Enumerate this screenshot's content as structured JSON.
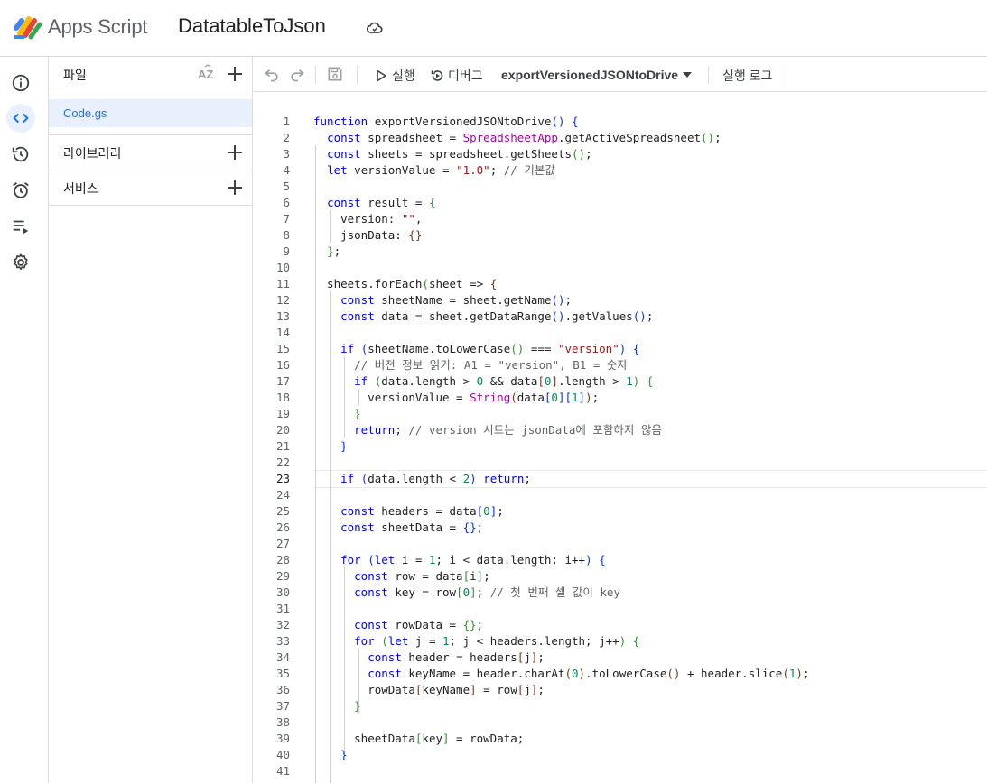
{
  "header": {
    "app_name": "Apps Script",
    "project_title": "DatatableToJson"
  },
  "filepanel": {
    "files_label": "파일",
    "files": [
      "Code.gs"
    ],
    "libraries_label": "라이브러리",
    "services_label": "서비스"
  },
  "toolbar": {
    "run_label": "실행",
    "debug_label": "디버그",
    "function_name": "exportVersionedJSONtoDrive",
    "log_label": "실행 로그"
  },
  "editor": {
    "current_line": 23,
    "lines": [
      [
        [
          "k",
          "function"
        ],
        [
          "f",
          " exportVersionedJSONtoDrive"
        ],
        [
          "b1",
          "()"
        ],
        [
          "f",
          " "
        ],
        [
          "b1",
          "{"
        ]
      ],
      [
        [
          "f",
          "  "
        ],
        [
          "k",
          "const"
        ],
        [
          "f",
          " spreadsheet = "
        ],
        [
          "cl",
          "SpreadsheetApp"
        ],
        [
          "f",
          ".getActiveSpreadsheet"
        ],
        [
          "b2",
          "()"
        ],
        [
          "f",
          ";"
        ]
      ],
      [
        [
          "f",
          "  "
        ],
        [
          "k",
          "const"
        ],
        [
          "f",
          " sheets = spreadsheet.getSheets"
        ],
        [
          "b2",
          "()"
        ],
        [
          "f",
          ";"
        ]
      ],
      [
        [
          "f",
          "  "
        ],
        [
          "k",
          "let"
        ],
        [
          "f",
          " versionValue = "
        ],
        [
          "s",
          "\"1.0\""
        ],
        [
          "f",
          "; "
        ],
        [
          "c",
          "// 기본값"
        ]
      ],
      [
        [
          "f",
          ""
        ]
      ],
      [
        [
          "f",
          "  "
        ],
        [
          "k",
          "const"
        ],
        [
          "f",
          " result = "
        ],
        [
          "b2",
          "{"
        ]
      ],
      [
        [
          "f",
          "    version: "
        ],
        [
          "s",
          "\"\""
        ],
        [
          "f",
          ","
        ]
      ],
      [
        [
          "f",
          "    jsonData: "
        ],
        [
          "b3",
          "{}"
        ]
      ],
      [
        [
          "f",
          "  "
        ],
        [
          "b2",
          "}"
        ],
        [
          "f",
          ";"
        ]
      ],
      [
        [
          "f",
          ""
        ]
      ],
      [
        [
          "f",
          "  sheets.forEach"
        ],
        [
          "b2",
          "("
        ],
        [
          "f",
          "sheet => "
        ],
        [
          "b3",
          "{"
        ]
      ],
      [
        [
          "f",
          "    "
        ],
        [
          "k",
          "const"
        ],
        [
          "f",
          " sheetName = sheet.getName"
        ],
        [
          "b1",
          "()"
        ],
        [
          "f",
          ";"
        ]
      ],
      [
        [
          "f",
          "    "
        ],
        [
          "k",
          "const"
        ],
        [
          "f",
          " data = sheet.getDataRange"
        ],
        [
          "b1",
          "()"
        ],
        [
          "f",
          ".getValues"
        ],
        [
          "b1",
          "()"
        ],
        [
          "f",
          ";"
        ]
      ],
      [
        [
          "f",
          ""
        ]
      ],
      [
        [
          "f",
          "    "
        ],
        [
          "k",
          "if"
        ],
        [
          "f",
          " "
        ],
        [
          "b1",
          "("
        ],
        [
          "f",
          "sheetName.toLowerCase"
        ],
        [
          "b2",
          "()"
        ],
        [
          "f",
          " === "
        ],
        [
          "s",
          "\"version\""
        ],
        [
          "b1",
          ")"
        ],
        [
          "f",
          " "
        ],
        [
          "b1",
          "{"
        ]
      ],
      [
        [
          "f",
          "      "
        ],
        [
          "c",
          "// 버전 정보 읽기: A1 = \"version\", B1 = 숫자"
        ]
      ],
      [
        [
          "f",
          "      "
        ],
        [
          "k",
          "if"
        ],
        [
          "f",
          " "
        ],
        [
          "b2",
          "("
        ],
        [
          "f",
          "data.length > "
        ],
        [
          "n",
          "0"
        ],
        [
          "f",
          " && data"
        ],
        [
          "b3",
          "["
        ],
        [
          "n",
          "0"
        ],
        [
          "b3",
          "]"
        ],
        [
          "f",
          ".length > "
        ],
        [
          "n",
          "1"
        ],
        [
          "b2",
          ")"
        ],
        [
          "f",
          " "
        ],
        [
          "b2",
          "{"
        ]
      ],
      [
        [
          "f",
          "        versionValue = "
        ],
        [
          "cl",
          "String"
        ],
        [
          "b3",
          "("
        ],
        [
          "f",
          "data"
        ],
        [
          "b1",
          "["
        ],
        [
          "n",
          "0"
        ],
        [
          "b1",
          "]["
        ],
        [
          "n",
          "1"
        ],
        [
          "b1",
          "]"
        ],
        [
          "b3",
          ")"
        ],
        [
          "f",
          ";"
        ]
      ],
      [
        [
          "f",
          "      "
        ],
        [
          "b2",
          "}"
        ]
      ],
      [
        [
          "f",
          "      "
        ],
        [
          "k",
          "return"
        ],
        [
          "f",
          "; "
        ],
        [
          "c",
          "// version 시트는 jsonData에 포함하지 않음"
        ]
      ],
      [
        [
          "f",
          "    "
        ],
        [
          "b1",
          "}"
        ]
      ],
      [
        [
          "f",
          ""
        ]
      ],
      [
        [
          "f",
          "    "
        ],
        [
          "k",
          "if"
        ],
        [
          "f",
          " "
        ],
        [
          "b1",
          "("
        ],
        [
          "f",
          "data.length < "
        ],
        [
          "n",
          "2"
        ],
        [
          "b1",
          ")"
        ],
        [
          "f",
          " "
        ],
        [
          "k",
          "return"
        ],
        [
          "f",
          ";"
        ]
      ],
      [
        [
          "f",
          ""
        ]
      ],
      [
        [
          "f",
          "    "
        ],
        [
          "k",
          "const"
        ],
        [
          "f",
          " headers = data"
        ],
        [
          "b1",
          "["
        ],
        [
          "n",
          "0"
        ],
        [
          "b1",
          "]"
        ],
        [
          "f",
          ";"
        ]
      ],
      [
        [
          "f",
          "    "
        ],
        [
          "k",
          "const"
        ],
        [
          "f",
          " sheetData = "
        ],
        [
          "b1",
          "{}"
        ],
        [
          "f",
          ";"
        ]
      ],
      [
        [
          "f",
          ""
        ]
      ],
      [
        [
          "f",
          "    "
        ],
        [
          "k",
          "for"
        ],
        [
          "f",
          " "
        ],
        [
          "b1",
          "("
        ],
        [
          "k",
          "let"
        ],
        [
          "f",
          " i = "
        ],
        [
          "n",
          "1"
        ],
        [
          "f",
          "; i < data.length; i++"
        ],
        [
          "b1",
          ")"
        ],
        [
          "f",
          " "
        ],
        [
          "b1",
          "{"
        ]
      ],
      [
        [
          "f",
          "      "
        ],
        [
          "k",
          "const"
        ],
        [
          "f",
          " row = data"
        ],
        [
          "b2",
          "["
        ],
        [
          "f",
          "i"
        ],
        [
          "b2",
          "]"
        ],
        [
          "f",
          ";"
        ]
      ],
      [
        [
          "f",
          "      "
        ],
        [
          "k",
          "const"
        ],
        [
          "f",
          " key = row"
        ],
        [
          "b2",
          "["
        ],
        [
          "n",
          "0"
        ],
        [
          "b2",
          "]"
        ],
        [
          "f",
          "; "
        ],
        [
          "c",
          "// 첫 번째 셀 값이 key"
        ]
      ],
      [
        [
          "f",
          ""
        ]
      ],
      [
        [
          "f",
          "      "
        ],
        [
          "k",
          "const"
        ],
        [
          "f",
          " rowData = "
        ],
        [
          "b2",
          "{}"
        ],
        [
          "f",
          ";"
        ]
      ],
      [
        [
          "f",
          "      "
        ],
        [
          "k",
          "for"
        ],
        [
          "f",
          " "
        ],
        [
          "b2",
          "("
        ],
        [
          "k",
          "let"
        ],
        [
          "f",
          " j = "
        ],
        [
          "n",
          "1"
        ],
        [
          "f",
          "; j < headers.length; j++"
        ],
        [
          "b2",
          ")"
        ],
        [
          "f",
          " "
        ],
        [
          "b2",
          "{"
        ]
      ],
      [
        [
          "f",
          "        "
        ],
        [
          "k",
          "const"
        ],
        [
          "f",
          " header = headers"
        ],
        [
          "b3",
          "["
        ],
        [
          "f",
          "j"
        ],
        [
          "b3",
          "]"
        ],
        [
          "f",
          ";"
        ]
      ],
      [
        [
          "f",
          "        "
        ],
        [
          "k",
          "const"
        ],
        [
          "f",
          " keyName = header.charAt"
        ],
        [
          "b3",
          "("
        ],
        [
          "n",
          "0"
        ],
        [
          "b3",
          ")"
        ],
        [
          "f",
          ".toLowerCase"
        ],
        [
          "b3",
          "()"
        ],
        [
          "f",
          " + header.slice"
        ],
        [
          "b3",
          "("
        ],
        [
          "n",
          "1"
        ],
        [
          "b3",
          ")"
        ],
        [
          "f",
          ";"
        ]
      ],
      [
        [
          "f",
          "        rowData"
        ],
        [
          "b3",
          "["
        ],
        [
          "f",
          "keyName"
        ],
        [
          "b3",
          "]"
        ],
        [
          "f",
          " = row"
        ],
        [
          "b3",
          "["
        ],
        [
          "f",
          "j"
        ],
        [
          "b3",
          "]"
        ],
        [
          "f",
          ";"
        ]
      ],
      [
        [
          "f",
          "      "
        ],
        [
          "b2",
          "}"
        ]
      ],
      [
        [
          "f",
          ""
        ]
      ],
      [
        [
          "f",
          "      sheetData"
        ],
        [
          "b2",
          "["
        ],
        [
          "f",
          "key"
        ],
        [
          "b2",
          "]"
        ],
        [
          "f",
          " = rowData;"
        ]
      ],
      [
        [
          "f",
          "    "
        ],
        [
          "b1",
          "}"
        ]
      ],
      [
        [
          "f",
          ""
        ]
      ]
    ]
  }
}
